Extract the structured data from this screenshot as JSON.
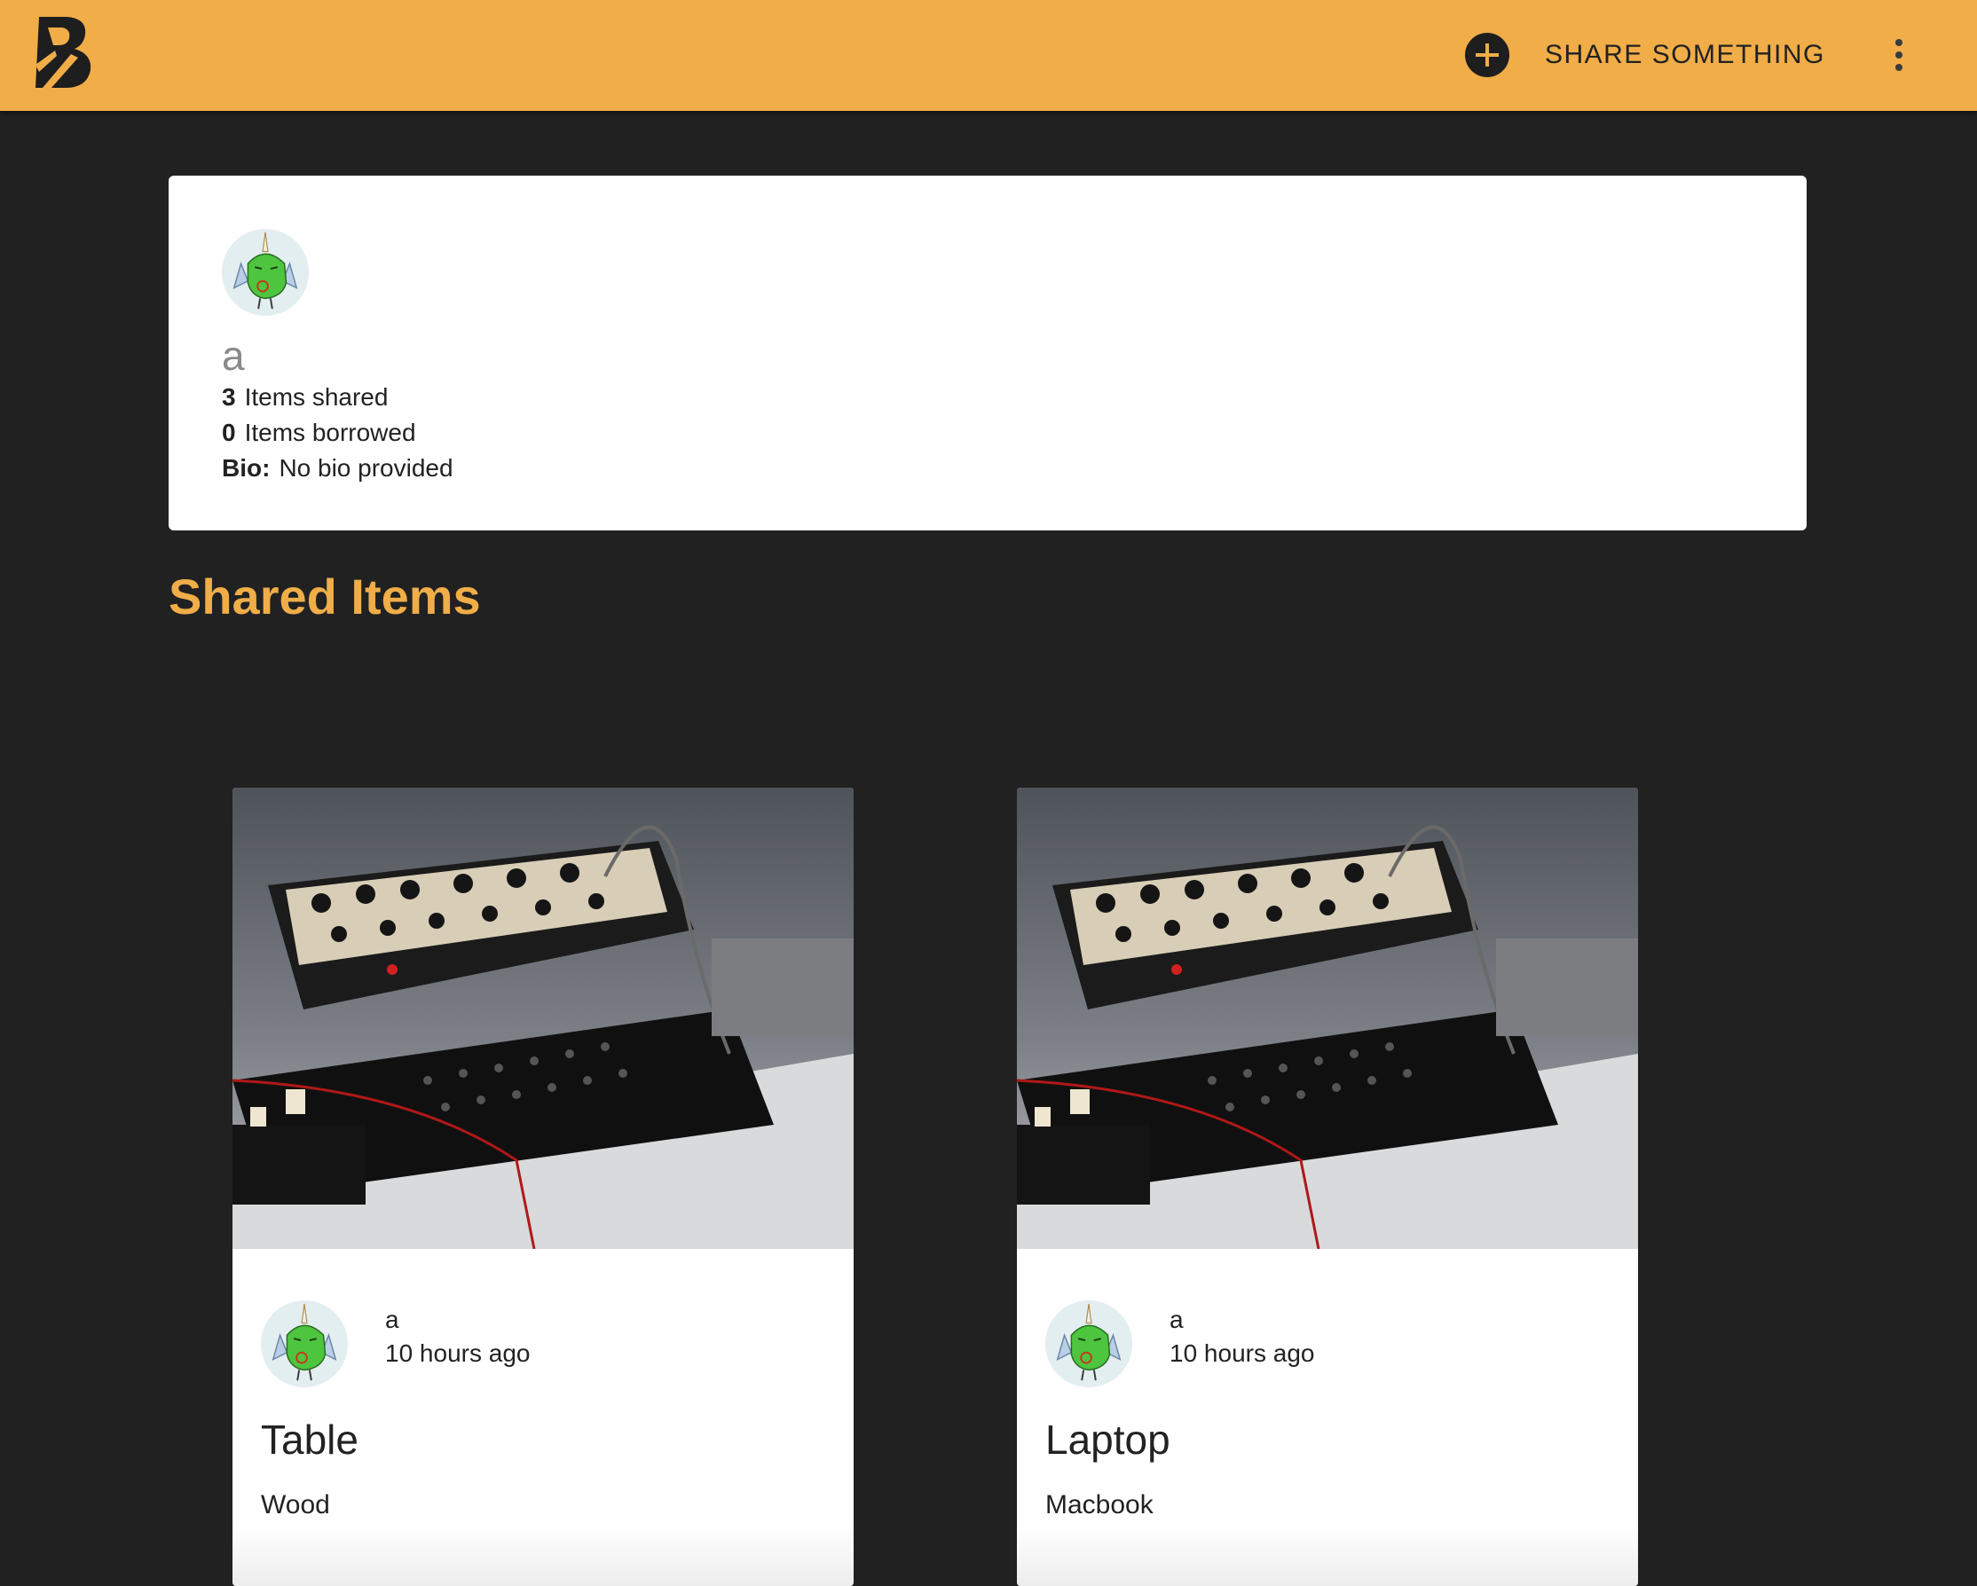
{
  "header": {
    "logo_icon": "boomtown-logo-icon",
    "share_icon": "plus-circle-icon",
    "share_label": "SHARE SOMETHING",
    "menu_icon": "more-vertical-icon",
    "bar_color": "#f0ad48"
  },
  "profile": {
    "avatar_icon": "green-bird-avatar",
    "name": "a",
    "items_shared_count": "3",
    "items_shared_label": "Items shared",
    "items_borrowed_count": "0",
    "items_borrowed_label": "Items borrowed",
    "bio_label": "Bio:",
    "bio_value": "No bio provided"
  },
  "section_title": "Shared Items",
  "items": [
    {
      "image_icon": "synthesizer-photo",
      "owner": "a",
      "time": "10 hours ago",
      "title": "Table",
      "description": "Wood"
    },
    {
      "image_icon": "synthesizer-photo",
      "owner": "a",
      "time": "10 hours ago",
      "title": "Laptop",
      "description": "Macbook"
    }
  ],
  "colors": {
    "accent": "#f0ad48",
    "background": "#212121",
    "card": "#ffffff"
  }
}
